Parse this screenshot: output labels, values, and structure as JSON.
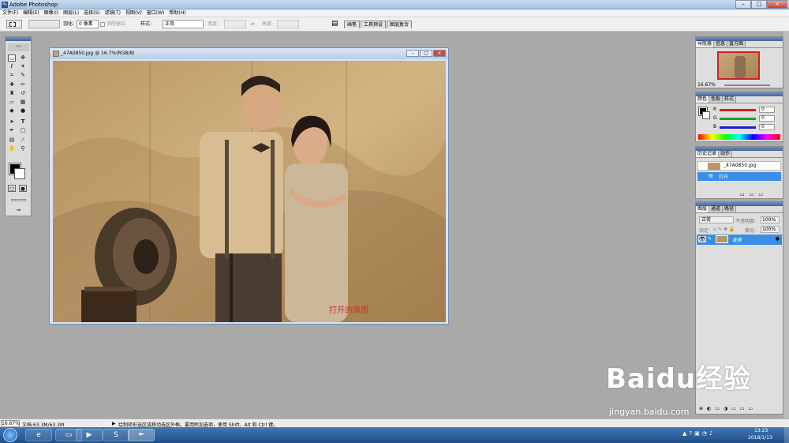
{
  "app": {
    "title": "Adobe Photoshop"
  },
  "menu": [
    "文件(F)",
    "编辑(E)",
    "图像(I)",
    "图层(L)",
    "选择(S)",
    "滤镜(T)",
    "视图(V)",
    "窗口(W)",
    "帮助(H)"
  ],
  "options": {
    "feather_label": "羽化:",
    "feather_value": "0 像素",
    "antialias_label": "消除锯齿",
    "style_label": "样式:",
    "style_value": "正常",
    "width_label": "宽度:",
    "height_label": "高度:"
  },
  "palette_well_tabs": [
    "画笔",
    "工具预设",
    "图层复合"
  ],
  "document": {
    "title": "_47A0850.jpg @ 16.7%(RGB/8)",
    "caption": "打开的原图"
  },
  "navigator": {
    "tabs": [
      "导航器",
      "信息",
      "直方图"
    ],
    "zoom": "16.67%"
  },
  "color_panel": {
    "tabs": [
      "颜色",
      "色板",
      "样式"
    ],
    "r_label": "R",
    "g_label": "G",
    "b_label": "B",
    "r": "0",
    "g": "0",
    "b": "0"
  },
  "history": {
    "tabs": [
      "历史记录",
      "动作"
    ],
    "snapshot": "_47A0850.jpg",
    "step": "打开"
  },
  "layers": {
    "tabs": [
      "图层",
      "通道",
      "路径"
    ],
    "blend_mode": "正常",
    "opacity_label": "不透明度:",
    "opacity": "100%",
    "lock_label": "锁定:",
    "fill_label": "填充:",
    "fill": "100%",
    "layer_name": "背景"
  },
  "status": {
    "zoom": "16.67%",
    "doc_size": "文档:63.3M/63.3M",
    "hint": "绘制矩形选区或移动选区外框。要用附加选项，使用 Shift、Alt 和 Ctrl 键。"
  },
  "taskbar": {
    "time": "13:23",
    "date": "2018/1/13"
  },
  "watermark": {
    "logo": "Baidu经验",
    "url": "jingyan.baidu.com"
  }
}
